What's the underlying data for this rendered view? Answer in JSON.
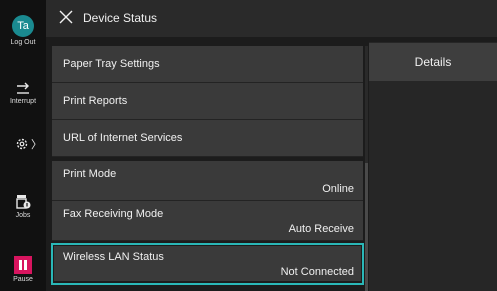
{
  "header": {
    "title": "Device Status"
  },
  "rail": {
    "avatar_initials": "Ta",
    "logout_label": "Log Out",
    "interrupt_label": "Interrupt",
    "jobs_label": "Jobs",
    "pause_label": "Pause",
    "settings_arrow": "〉"
  },
  "list": {
    "items": [
      {
        "label": "Paper Tray Settings"
      },
      {
        "label": "Print Reports"
      },
      {
        "label": "URL of Internet Services"
      },
      {
        "label": "Print Mode",
        "value": "Online"
      },
      {
        "label": "Fax Receiving Mode",
        "value": "Auto Receive"
      },
      {
        "label": "Wireless LAN Status",
        "value": "Not Connected",
        "selected": true
      }
    ]
  },
  "panel": {
    "details_label": "Details"
  },
  "colors": {
    "accent": "#2ab7b7",
    "pause": "#d8155f",
    "avatar": "#1a8a90"
  }
}
